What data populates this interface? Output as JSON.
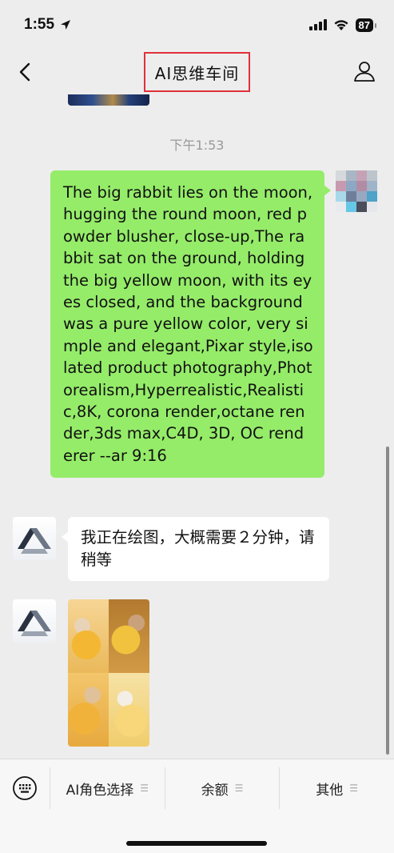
{
  "status_bar": {
    "time": "1:55",
    "battery": "87"
  },
  "nav": {
    "title": "AI思维车间"
  },
  "chat": {
    "timestamp": "下午1:53",
    "user_message": "The big rabbit lies on the moon, hugging the round moon, red powder blusher, close-up,The rabbit sat on the ground, holding the big yellow moon, with its eyes closed, and the background was a pure yellow color, very simple and elegant,Pixar style,isolated product photography,Photorealism,Hyperrealistic,Realistic,8K, corona render,octane render,3ds max,C4D, 3D, OC renderer --ar 9:16",
    "bot_message": "我正在绘图，大概需要２分钟，请稍等"
  },
  "bottom_menu": {
    "items": [
      {
        "label": "AI角色选择"
      },
      {
        "label": "余额"
      },
      {
        "label": "其他"
      }
    ]
  },
  "colors": {
    "user_bubble": "#95ec69",
    "title_highlight": "#e0303a",
    "background": "#ededed"
  }
}
